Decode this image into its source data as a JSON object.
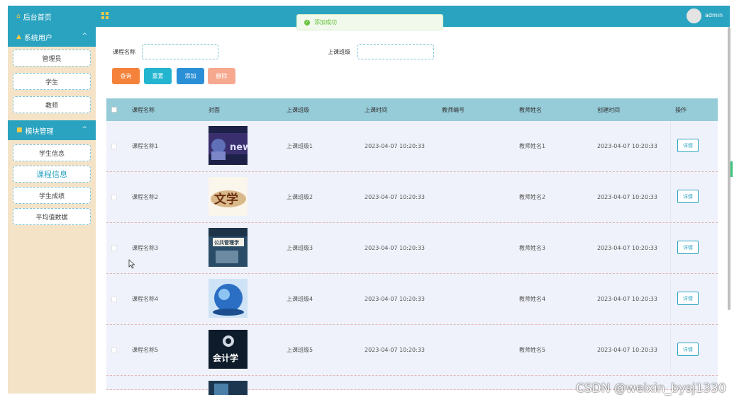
{
  "sidebar": {
    "home_label": "后台首页",
    "groups": [
      {
        "label": "系统用户",
        "items": [
          "管理员",
          "学生",
          "教师"
        ]
      },
      {
        "label": "模块管理",
        "items": [
          "学生信息",
          "课程信息",
          "学生成绩",
          "平均值数据"
        ]
      }
    ],
    "active_item": "课程信息"
  },
  "topbar": {
    "user_name": "admin"
  },
  "toast": {
    "message": "添加成功"
  },
  "search": {
    "course_name_label": "课程名称",
    "course_name_value": "",
    "class_label": "上课班级",
    "class_value": ""
  },
  "buttons": {
    "query": "查询",
    "reset": "重置",
    "add": "添加",
    "delete": "删除"
  },
  "table": {
    "headers": [
      "课程名称",
      "封面",
      "上课班级",
      "上课时间",
      "教师编号",
      "教师姓名",
      "创建时间",
      "操作"
    ],
    "rows": [
      {
        "course": "课程名称1",
        "cover": "news",
        "klass": "上课班级1",
        "time": "2023-04-07 10:20:33",
        "teacher_no": "",
        "teacher": "教师姓名1",
        "created": "2023-04-07 10:20:33",
        "action": "详情"
      },
      {
        "course": "课程名称2",
        "cover": "文学",
        "klass": "上课班级2",
        "time": "2023-04-07 10:20:33",
        "teacher_no": "",
        "teacher": "教师姓名2",
        "created": "2023-04-07 10:20:33",
        "action": "详情"
      },
      {
        "course": "课程名称3",
        "cover": "公共管理学",
        "klass": "上课班级3",
        "time": "2023-04-07 10:20:33",
        "teacher_no": "",
        "teacher": "教师姓名3",
        "created": "2023-04-07 10:20:33",
        "action": "详情"
      },
      {
        "course": "课程名称4",
        "cover": "globe",
        "klass": "上课班级4",
        "time": "2023-04-07 10:20:33",
        "teacher_no": "",
        "teacher": "教师姓名4",
        "created": "2023-04-07 10:20:33",
        "action": "详情"
      },
      {
        "course": "课程名称5",
        "cover": "会计学",
        "klass": "上课班级5",
        "time": "2023-04-07 10:20:33",
        "teacher_no": "",
        "teacher": "教师姓名5",
        "created": "2023-04-07 10:20:33",
        "action": "详情"
      }
    ]
  },
  "watermark": "CSDN @weixin_bysj1330",
  "colors": {
    "primary": "#2aa3c0",
    "query": "#f5823a",
    "reset": "#23b5cf",
    "add": "#2a8fd6",
    "delete": "#f6a98f",
    "sidebar_bg": "#f5e3c8"
  }
}
